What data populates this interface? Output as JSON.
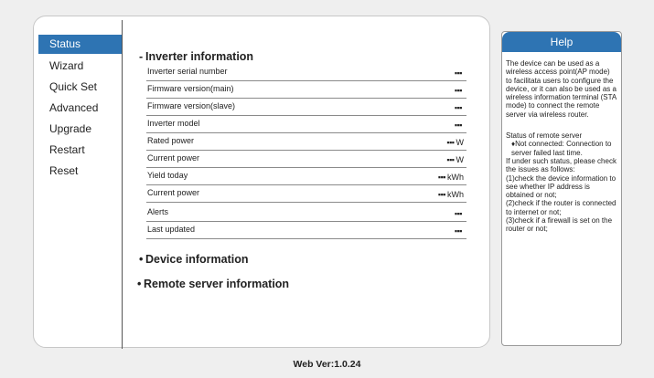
{
  "nav": {
    "items": [
      {
        "label": "Status"
      },
      {
        "label": "Wizard"
      },
      {
        "label": "Quick Set"
      },
      {
        "label": "Advanced"
      },
      {
        "label": "Upgrade"
      },
      {
        "label": "Restart"
      },
      {
        "label": "Reset"
      }
    ]
  },
  "inverter": {
    "title": "Inverter information",
    "rows": [
      {
        "label": "Inverter serial number",
        "value": "▪▪▪",
        "unit": ""
      },
      {
        "label": "Firmware version(main)",
        "value": "▪▪▪",
        "unit": ""
      },
      {
        "label": "Firmware version(slave)",
        "value": "▪▪▪",
        "unit": ""
      },
      {
        "label": "Inverter model",
        "value": "▪▪▪",
        "unit": ""
      },
      {
        "label": "Rated power",
        "value": "▪▪▪",
        "unit": "W"
      },
      {
        "label": "Current power",
        "value": "▪▪▪",
        "unit": "W"
      },
      {
        "label": "Yield today",
        "value": "▪▪▪",
        "unit": "kWh"
      },
      {
        "label": "Current power",
        "value": "▪▪▪",
        "unit": "kWh"
      },
      {
        "label": "Alerts",
        "value": "▪▪▪",
        "unit": ""
      },
      {
        "label": "Last updated",
        "value": "▪▪▪",
        "unit": ""
      }
    ]
  },
  "device": {
    "title": "Device information"
  },
  "remote": {
    "title": "Remote server information"
  },
  "help": {
    "title": "Help",
    "para1": "The device can be used as a wireless access point(AP mode) to facilitata users to configure the device, or it can also be used as a wireless information terminal (STA mode) to connect the remote server via wireless router.",
    "status_heading": "Status of remote server",
    "not_connected": "♦Not connected: Connection to server failed last time.",
    "issues_intro": "If under such status, please check the issues as follows:",
    "check1": "(1)check the device information to see whether IP address is obtained or not;",
    "check2": "(2)check if the router is connected to internet or not;",
    "check3": "(3)check if a firewall is set on the router or not;"
  },
  "footer": {
    "version": "Web Ver:1.0.24"
  }
}
